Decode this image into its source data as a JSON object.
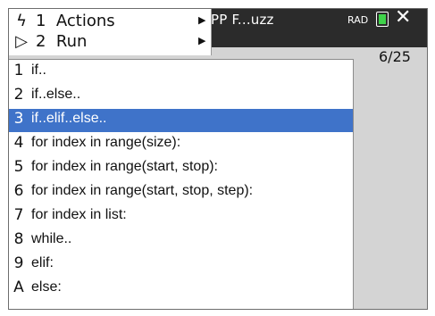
{
  "window": {
    "doc_title": "PP F...uzz",
    "angle_mode": "RAD",
    "page_indicator": "6/25"
  },
  "colors": {
    "titlebar": "#2b2b2b",
    "workspace": "#d4d4d4",
    "selection": "#3f73c9",
    "battery": "#3fd24a"
  },
  "top_menu": {
    "items": [
      {
        "number": "1",
        "label": "Actions",
        "icon": "lightning-icon",
        "glyph": "ϟ"
      },
      {
        "number": "2",
        "label": "Run",
        "icon": "triangle-right-icon",
        "glyph": "▷"
      }
    ]
  },
  "submenu": {
    "selected_index": 2,
    "items": [
      {
        "key": "1",
        "label": "if.."
      },
      {
        "key": "2",
        "label": "if..else.."
      },
      {
        "key": "3",
        "label": "if..elif..else.."
      },
      {
        "key": "4",
        "label": "for index in range(size):"
      },
      {
        "key": "5",
        "label": "for index in range(start, stop):"
      },
      {
        "key": "6",
        "label": "for index in range(start, stop, step):"
      },
      {
        "key": "7",
        "label": "for index in list:"
      },
      {
        "key": "8",
        "label": "while.."
      },
      {
        "key": "9",
        "label": "elif:"
      },
      {
        "key": "A",
        "label": "else:"
      }
    ]
  }
}
